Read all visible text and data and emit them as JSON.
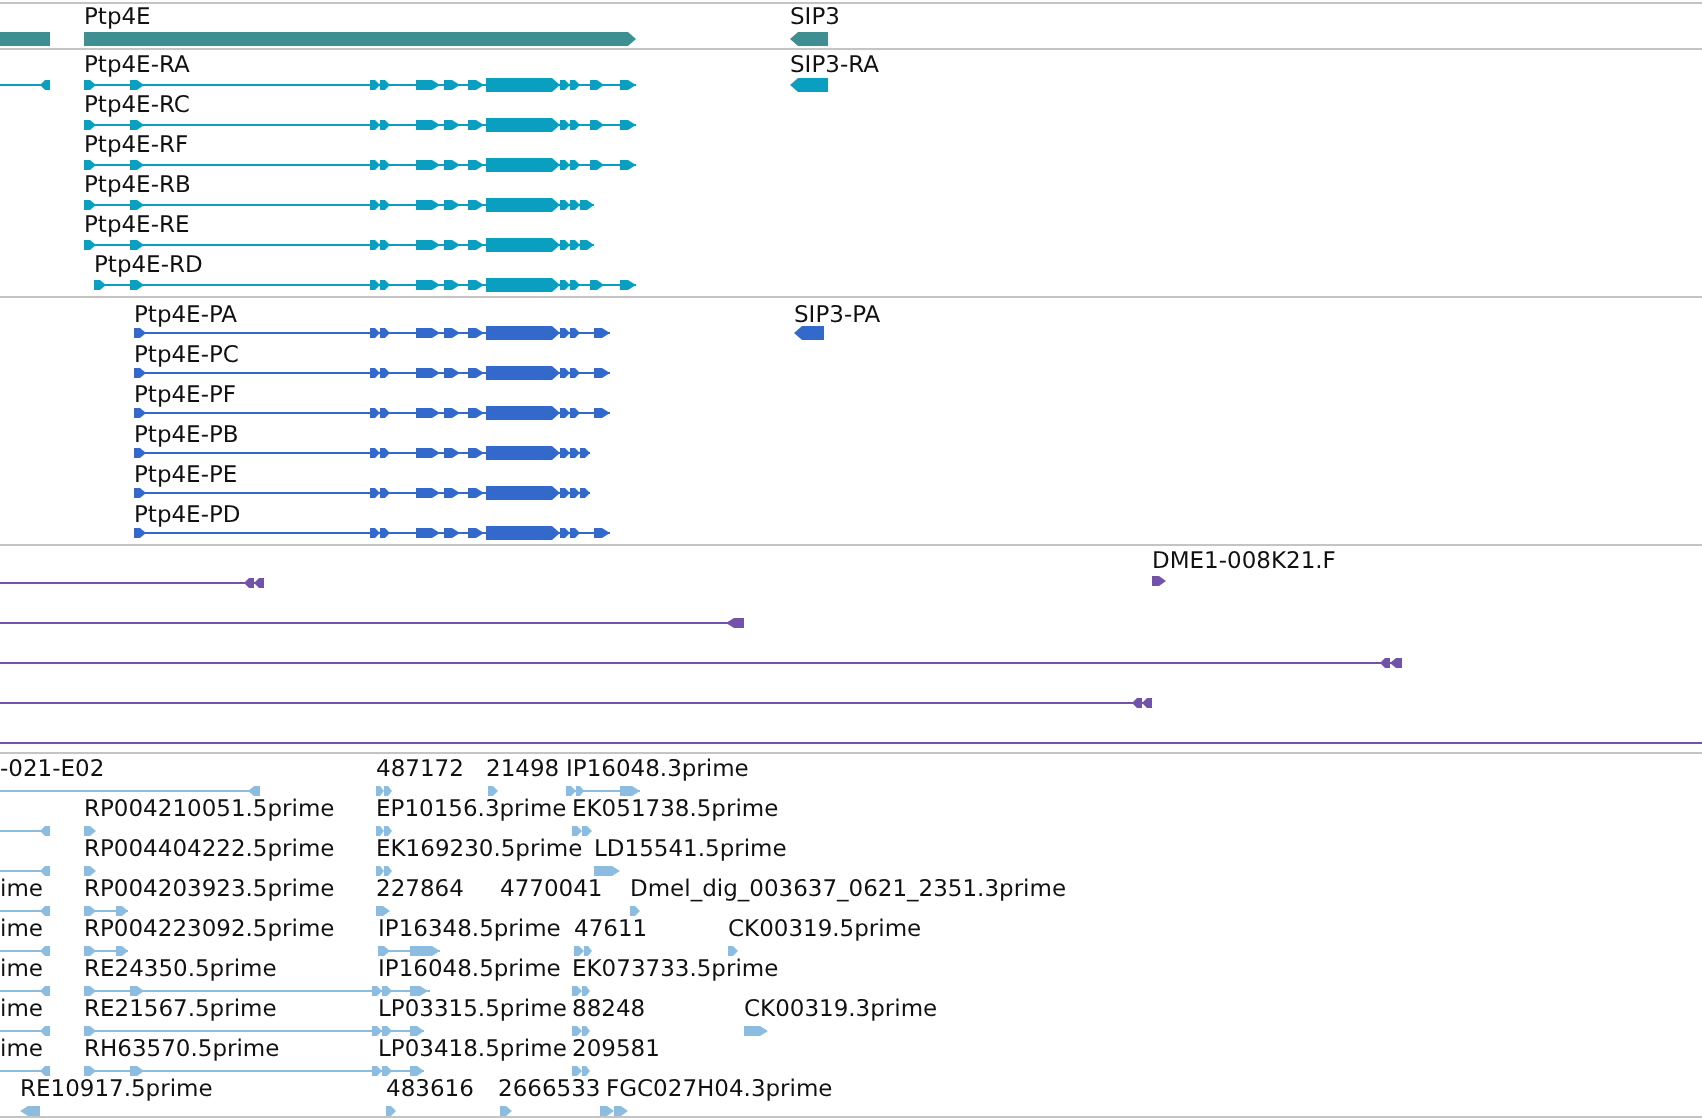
{
  "tracks": [
    {
      "kind": "genes",
      "color": "#3d8f92",
      "features": [
        {
          "label": "Ptp4E"
        },
        {
          "label": "SIP3"
        }
      ]
    },
    {
      "kind": "transcripts",
      "color": "#0a9fc0",
      "features": [
        {
          "label": "Ptp4E-RA"
        },
        {
          "label": "SIP3-RA"
        },
        {
          "label": "Ptp4E-RC"
        },
        {
          "label": "Ptp4E-RF"
        },
        {
          "label": "Ptp4E-RB"
        },
        {
          "label": "Ptp4E-RE"
        },
        {
          "label": "Ptp4E-RD"
        }
      ]
    },
    {
      "kind": "proteins",
      "color": "#3469cc",
      "features": [
        {
          "label": "Ptp4E-PA"
        },
        {
          "label": "SIP3-PA"
        },
        {
          "label": "Ptp4E-PC"
        },
        {
          "label": "Ptp4E-PF"
        },
        {
          "label": "Ptp4E-PB"
        },
        {
          "label": "Ptp4E-PE"
        },
        {
          "label": "Ptp4E-PD"
        }
      ]
    },
    {
      "kind": "clones",
      "color": "#7252aa",
      "features": [
        {
          "label": "DME1-008K21.F"
        }
      ]
    },
    {
      "kind": "ests",
      "color": "#8cbde0",
      "features": [
        {
          "label": "-021-E02"
        },
        {
          "label": "487172"
        },
        {
          "label": "21498"
        },
        {
          "label": "IP16048.3prime"
        },
        {
          "label": "RP004210051.5prime"
        },
        {
          "label": "EP10156.3prime"
        },
        {
          "label": "EK051738.5prime"
        },
        {
          "label": "RP004404222.5prime"
        },
        {
          "label": "EK169230.5prime"
        },
        {
          "label": "LD15541.5prime"
        },
        {
          "label": "ime"
        },
        {
          "label": "RP004203923.5prime"
        },
        {
          "label": "227864"
        },
        {
          "label": "4770041"
        },
        {
          "label": "Dmel_dig_003637_0621_2351.3prime"
        },
        {
          "label": "ime"
        },
        {
          "label": "RP004223092.5prime"
        },
        {
          "label": "IP16348.5prime"
        },
        {
          "label": "47611"
        },
        {
          "label": "CK00319.5prime"
        },
        {
          "label": "ime"
        },
        {
          "label": "RE24350.5prime"
        },
        {
          "label": "IP16048.5prime"
        },
        {
          "label": "EK073733.5prime"
        },
        {
          "label": "ime"
        },
        {
          "label": "RE21567.5prime"
        },
        {
          "label": "LP03315.5prime"
        },
        {
          "label": "88248"
        },
        {
          "label": "CK00319.3prime"
        },
        {
          "label": "ime"
        },
        {
          "label": "RH63570.5prime"
        },
        {
          "label": "LP03418.5prime"
        },
        {
          "label": "209581"
        },
        {
          "label": "RE10917.5prime"
        },
        {
          "label": "483616"
        },
        {
          "label": "2666533"
        },
        {
          "label": "FGC027H04.3prime"
        }
      ]
    }
  ]
}
